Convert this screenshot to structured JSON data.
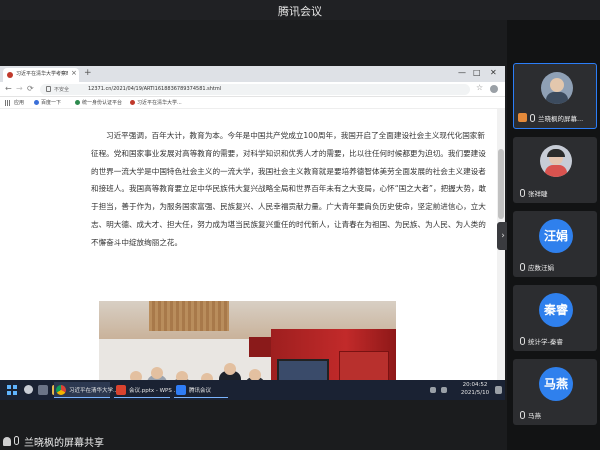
{
  "meeting": {
    "title": "腾讯会议"
  },
  "browser": {
    "tab_title": "习近平在清华大学考察时强调 走...",
    "tab_close": "×",
    "tab_new": "+",
    "window_controls": {
      "minimize": "—",
      "maximize": "□",
      "close": "✕"
    },
    "nav": {
      "back": "←",
      "forward": "→",
      "reload": "⟳"
    },
    "security_label": "不安全",
    "url": "12371.cn/2021/04/19/ARTI1618836789374581.shtml",
    "bookmarks": [
      {
        "label": "应用"
      },
      {
        "label": "百度一下"
      },
      {
        "label": "统一身份认证平台"
      },
      {
        "label": "习近平在清华大学..."
      }
    ]
  },
  "article": {
    "paragraph": "习近平强调，百年大计，教育为本。今年是中国共产党成立100周年，我国开启了全面建设社会主义现代化国家新征程。党和国家事业发展对高等教育的需要，对科学知识和优秀人才的需要，比以往任何时候都更为迫切。我们要建设的世界一流大学是中国特色社会主义的一流大学，我国社会主义教育就是要培养德智体美劳全面发展的社会主义建设者和接班人。我国高等教育要立足中华民族伟大复兴战略全局和世界百年未有之大变局，心怀“国之大者”，把握大势，敢于担当，善于作为，为服务国家富强、民族复兴、人民幸福贡献力量。广大青年要肩负历史使命，坚定前进信心，立大志、明大德、成大才、担大任，努力成为堪当民族复兴重任的时代新人，让青春在为祖国、为民族、为人民、为人类的不懈奋斗中绽放绚丽之花。"
  },
  "taskbar": {
    "items": [
      {
        "label": "习近平在清华大学..."
      },
      {
        "label": "会议.pptx - WPS ..."
      },
      {
        "label": "腾讯会议"
      }
    ],
    "time": "20:04:52",
    "date": "2021/5/10",
    "accent": "#7ab4ff"
  },
  "participants": [
    {
      "name": "兰晓枫的屏幕...",
      "avatar_type": "photo",
      "active": true,
      "host": true
    },
    {
      "name": "张祥睫",
      "avatar_type": "photo",
      "active": false,
      "host": false
    },
    {
      "name": "应数汪娟",
      "avatar_type": "text",
      "avatar_text": "汪娟",
      "color": "#2f80ed",
      "active": false,
      "host": false
    },
    {
      "name": "统计学-秦睿",
      "avatar_type": "text",
      "avatar_text": "秦睿",
      "color": "#2f80ed",
      "active": false,
      "host": false
    },
    {
      "name": "马燕",
      "avatar_type": "text",
      "avatar_text": "马燕",
      "color": "#2f80ed",
      "active": false,
      "host": false
    }
  ],
  "sharing_label": "兰晓枫的屏幕共享",
  "expand_arrow": "›"
}
